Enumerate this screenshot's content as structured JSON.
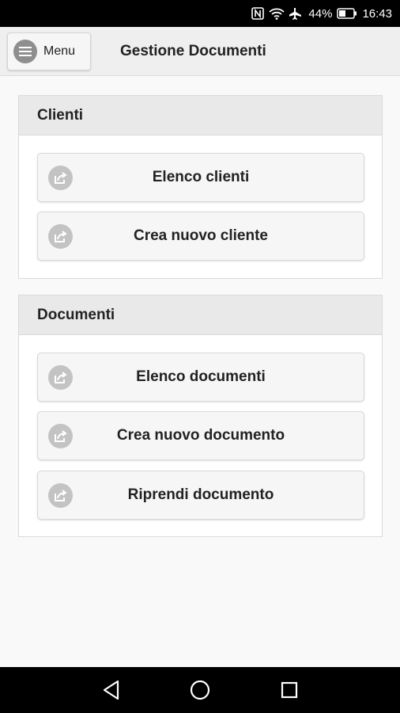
{
  "status_bar": {
    "battery": "44%",
    "time": "16:43",
    "icons": [
      "nfc-icon",
      "wifi-icon",
      "airplane-icon",
      "battery-icon"
    ]
  },
  "header": {
    "menu_label": "Menu",
    "title": "Gestione Documenti"
  },
  "sections": [
    {
      "title": "Clienti",
      "buttons": [
        "Elenco clienti",
        "Crea nuovo cliente"
      ]
    },
    {
      "title": "Documenti",
      "buttons": [
        "Elenco documenti",
        "Crea nuovo documento",
        "Riprendi documento"
      ]
    }
  ],
  "nav_bar": {
    "icons": [
      "back-icon",
      "home-icon",
      "recents-icon"
    ]
  }
}
